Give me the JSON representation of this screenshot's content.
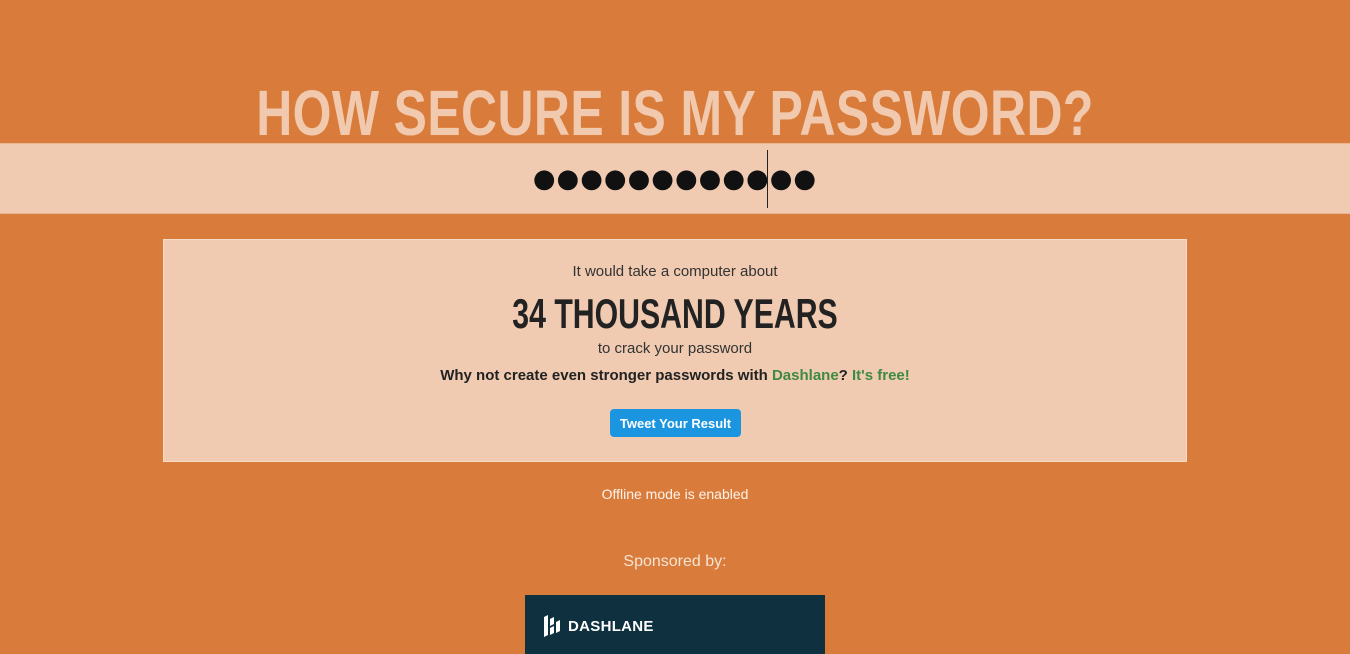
{
  "header": {
    "title": "HOW SECURE IS MY PASSWORD?"
  },
  "password": {
    "masked_value": "●●●●●●●●●●●●"
  },
  "result": {
    "intro": "It would take a computer about",
    "duration": "34 THOUSAND YEARS",
    "outro": "to crack your password",
    "promo_prefix": "Why not create even stronger passwords with ",
    "promo_link": "Dashlane",
    "promo_mid": "? ",
    "promo_free": "It's free!",
    "tweet_label": "Tweet Your Result"
  },
  "status": {
    "offline": "Offline mode is enabled"
  },
  "sponsor": {
    "label": "Sponsored by:",
    "logo_text": "DASHLANE",
    "logo_icon": "dashlane-logo-icon"
  },
  "colors": {
    "background": "#d97c3b",
    "panel": "#f0cbb1",
    "title": "#f0c9ae",
    "link": "#3f8a43",
    "tweet_button": "#1b95e0",
    "sponsor_banner": "#0f313f"
  }
}
